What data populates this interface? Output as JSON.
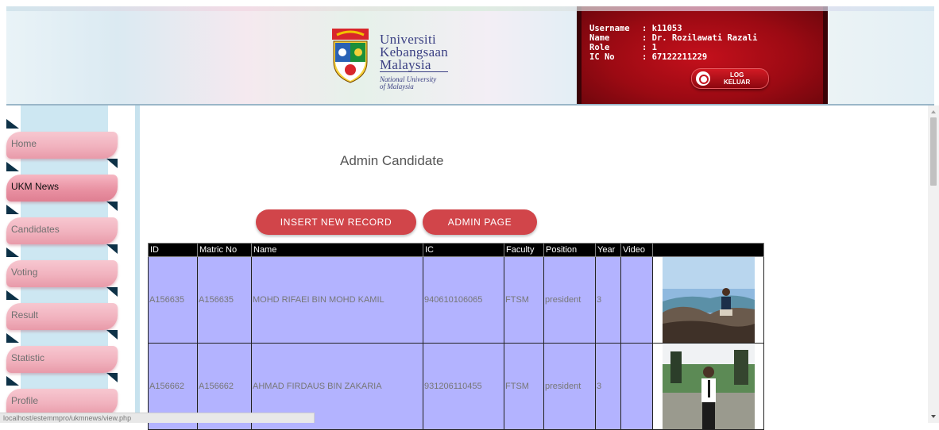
{
  "header": {
    "logo": {
      "line1": "Universiti",
      "line2": "Kebangsaan",
      "line3": "Malaysia",
      "sub1": "National University",
      "sub2": "of Malaysia"
    },
    "user": {
      "username_label": "Username",
      "username_value": ": k11053",
      "name_label": "Name",
      "name_value": ": Dr. Rozilawati Razali",
      "role_label": "Role",
      "role_value": ": 1",
      "ic_label": "IC No",
      "ic_value": ": 67122211229"
    },
    "logout_line1": "LOG",
    "logout_line2": "KELUAR",
    "colors": {
      "userbox": "#c4101c",
      "accent": "#d1454a"
    }
  },
  "sidebar": {
    "items": [
      {
        "label": "Home"
      },
      {
        "label": "UKM News"
      },
      {
        "label": "Candidates"
      },
      {
        "label": "Voting"
      },
      {
        "label": "Result"
      },
      {
        "label": "Statistic"
      },
      {
        "label": "Profile"
      }
    ],
    "active": "UKM News"
  },
  "main": {
    "title": "Admin Candidate",
    "insert_button": "INSERT NEW RECORD",
    "admin_button": "ADMIN PAGE",
    "table": {
      "headers": [
        "ID",
        "Matric No",
        "Name",
        "IC",
        "Faculty",
        "Position",
        "Year",
        "Video",
        ""
      ],
      "rows": [
        {
          "id": "A156635",
          "matric": "A156635",
          "name": "MOHD RIFAEI BIN MOHD KAMIL",
          "ic": "940610106065",
          "faculty": "FTSM",
          "position": "president",
          "year": "3",
          "video": ""
        },
        {
          "id": "A156662",
          "matric": "A156662",
          "name": "AHMAD FIRDAUS BIN ZAKARIA",
          "ic": "931206110455",
          "faculty": "FTSM",
          "position": "president",
          "year": "3",
          "video": ""
        }
      ]
    }
  },
  "statusbar": {
    "url": "localhost/estemmpro/ukmnews/view.php"
  }
}
